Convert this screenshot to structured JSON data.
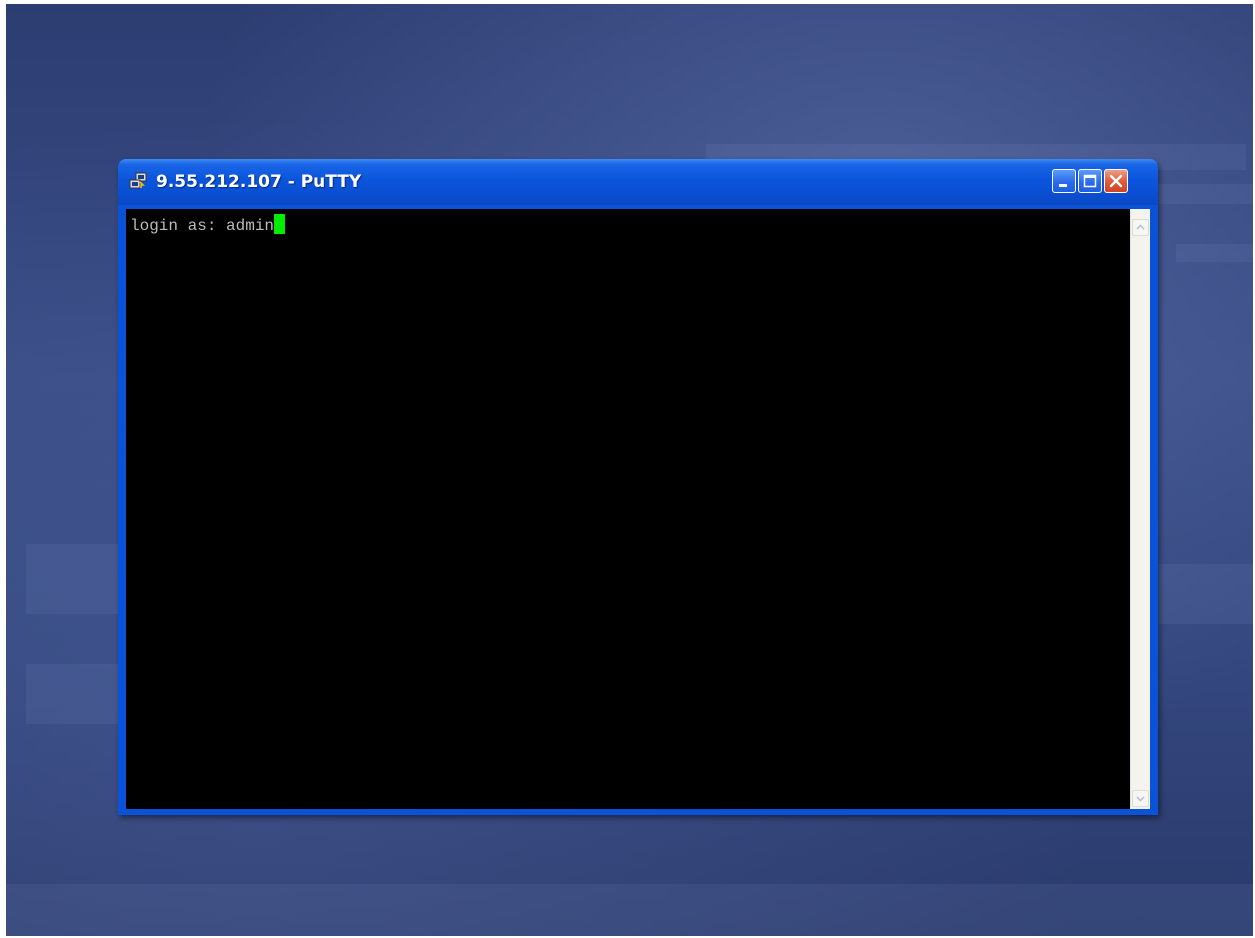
{
  "window": {
    "title": "9.55.212.107 - PuTTY"
  },
  "terminal": {
    "lines": [
      "login as: admin"
    ],
    "text_color": "#bbbbbb",
    "background": "#000000",
    "cursor_color": "#00ee00"
  },
  "icons": {
    "app": "putty-icon",
    "minimize": "minimize-icon",
    "maximize": "maximize-icon",
    "close": "close-icon",
    "scroll_up": "scroll-up-arrow-icon",
    "scroll_down": "scroll-down-arrow-icon"
  },
  "colors": {
    "titlebar": "#0a55dc",
    "close_button": "#e25c3a",
    "desktop": "#34477f"
  }
}
